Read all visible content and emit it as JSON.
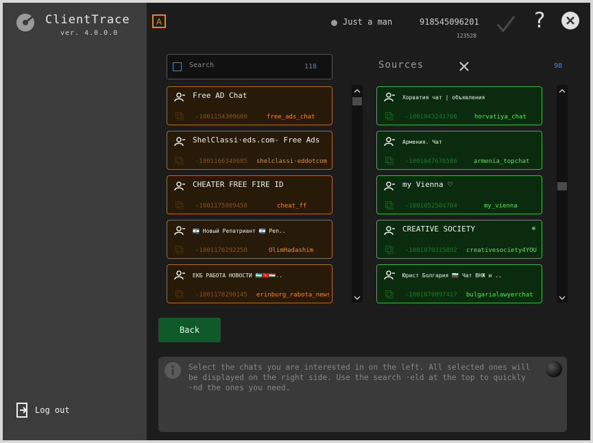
{
  "app": {
    "title": "ClientTrace",
    "version": "ver. 4.0.0.0",
    "logout_label": "Log out"
  },
  "header": {
    "user_name": "Just a man",
    "phone": "918545096201",
    "user_id": "123528"
  },
  "search": {
    "placeholder": "Search",
    "count": "118"
  },
  "sources": {
    "title": "Sources",
    "count": "98"
  },
  "left_chats": [
    {
      "title": "Free AD Chat",
      "id": "-1001154300680",
      "username": "free_ads_chat"
    },
    {
      "title": "ShelClassi·eds.com- Free Ads",
      "id": "-1001166340685",
      "username": "shelclassi·eddotcom"
    },
    {
      "title": "CHEATER FREE FIRE ID",
      "id": "-1001175009450",
      "username": "cheat_ff"
    },
    {
      "title": "🇮🇱 Новый Репатриант 🇮🇱 Реп..",
      "id": "-1001176292258",
      "username": "OlimHadashim"
    },
    {
      "title": "ЕКБ РАБОТА НОВОСТИ 🇺🇿🇰🇬🇹🇯..",
      "id": "-1001178290145",
      "username": "erinburg_rabota_news"
    }
  ],
  "right_chats": [
    {
      "title": "Хорватия чат | объявления",
      "id": "-1001043241700",
      "username": "horvatiya_chat"
    },
    {
      "title": "Армения. Чат",
      "id": "-1001047676586",
      "username": "armenia_topchat"
    },
    {
      "title": "my Vienna ♡",
      "id": "-1001052504764",
      "username": "my_vienna"
    },
    {
      "title": "CREATIVE SOCIETY",
      "id": "-1001070315892",
      "username": "creativesociety4YOU"
    },
    {
      "title": "Юрист Болгария 🇧🇬 Чат ВНЖ и ..",
      "id": "-1001070097417",
      "username": "bulgarialawyerchat"
    }
  ],
  "buttons": {
    "back": "Back"
  },
  "info": {
    "text": "Select the chats you are interested in on the left. All selected ones will be displayed on the right side. Use the search ·eld at the top to quickly ·nd the ones you need."
  },
  "colors": {
    "left_border": "#b06a18",
    "left_accent": "#f08a2a",
    "right_border": "#3cb34a",
    "right_accent": "#5ee05e",
    "accent_blue": "#4a86d8",
    "back_button": "#0f5a28"
  },
  "icons": {
    "logo": "clienttrace-logo-icon",
    "account": "account-a-icon",
    "check": "check-icon",
    "help": "help-icon",
    "close": "close-icon",
    "user": "user-icon",
    "copy": "copy-icon",
    "info": "info-icon",
    "logout": "logout-icon"
  }
}
